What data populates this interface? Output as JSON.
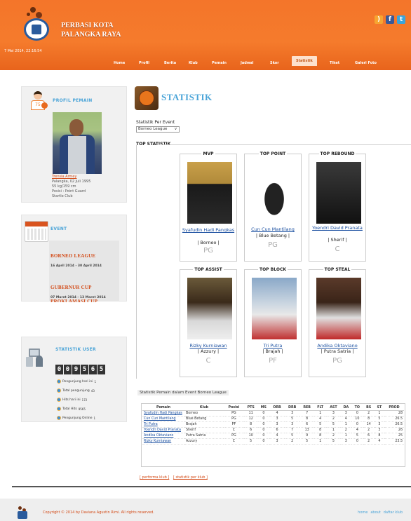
{
  "header": {
    "site_title": "PERBASI KOTA\nPALANGKA RAYA",
    "datetime": "7 Mei 2014, 22:16:54",
    "social": [
      "rss-icon",
      "facebook-icon",
      "twitter-icon"
    ]
  },
  "nav": {
    "items": [
      "Home",
      "Profil",
      "Berita",
      "Klub",
      "Pemain",
      "Jadwal",
      "Skor",
      "Statistik",
      "Tiket",
      "Galeri Foto"
    ],
    "active": "Statistik"
  },
  "profil": {
    "title": "PROFIL PEMAIN",
    "jersey": "75",
    "name": "Trensia Armey",
    "born": "Palangka, 02 Juli 1995",
    "body": "55 kg/159 cm",
    "position": "Posisi : Point Guard",
    "club": "Startle Club"
  },
  "event": {
    "title": "EVENT",
    "items": [
      {
        "name": "BORNEO LEAGUE",
        "date": "16 April 2014 - 30 April 2014"
      },
      {
        "name": "GUBERNUR CUP",
        "date": "07 Maret 2014 - 13 Maret 2014"
      },
      {
        "name": "PROKLAMASI CUP",
        "date": ""
      }
    ]
  },
  "stat_user": {
    "title": "STATISTIK USER",
    "counter": [
      "0",
      "0",
      "9",
      "5",
      "6",
      "5"
    ],
    "rows": [
      {
        "label": "Pengunjung hari ini",
        "value": "1"
      },
      {
        "label": "Total pengunjung",
        "value": "43"
      },
      {
        "label": "Hits hari ini",
        "value": "172"
      },
      {
        "label": "Total Hits",
        "value": "9565"
      },
      {
        "label": "Pengunjung Online",
        "value": "1"
      }
    ]
  },
  "main": {
    "title": "STATISTIK",
    "select_label": "Statistik Per Event",
    "select_value": "Borneo League",
    "top_label": "TOP STATISTIK"
  },
  "top_cards": [
    {
      "title": "MVP",
      "name": "Syafudin Hadi Pangkas",
      "club": "| Borneo |",
      "pos": "PG"
    },
    {
      "title": "TOP POINT",
      "name": "Cun Cun Mantilang",
      "club": "| Blue Betang |",
      "pos": "PG"
    },
    {
      "title": "TOP REBOUND",
      "name": "Yoendri David Pranata",
      "club": "| Sherif |",
      "pos": "C"
    },
    {
      "title": "TOP ASSIST",
      "name": "Rizky Kurniawan",
      "club": "| Azzury |",
      "pos": "C"
    },
    {
      "title": "TOP BLOCK",
      "name": "Tri Putra",
      "club": "| Brajah |",
      "pos": "PF"
    },
    {
      "title": "TOP STEAL",
      "name": "Andika Oktaviano",
      "club": "| Putra Satria |",
      "pos": "PG"
    }
  ],
  "table": {
    "caption": "Statistik Pemain dalam Event Borneo League",
    "headers": [
      "Pemain",
      "Klub",
      "Posisi",
      "PTS",
      "MS",
      "ORB",
      "DRB",
      "REB",
      "FLT",
      "AST",
      "DA",
      "TO",
      "BS",
      "ST",
      "PROD"
    ],
    "rows": [
      [
        "Syafudin Hadi Pangkas",
        "Borneo",
        "PG",
        "11",
        "0",
        "4",
        "3",
        "7",
        "1",
        "3",
        "3",
        "0",
        "2",
        "1",
        "28"
      ],
      [
        "Cun Cun Mantilang",
        "Blue Betang",
        "PG",
        "12",
        "0",
        "3",
        "5",
        "8",
        "4",
        "2",
        "4",
        "10",
        "8",
        "5",
        "26.5"
      ],
      [
        "Tri Putra",
        "Brajah",
        "PF",
        "8",
        "0",
        "3",
        "3",
        "6",
        "5",
        "5",
        "1",
        "0",
        "14",
        "3",
        "26.5"
      ],
      [
        "Yoendri David Pranata",
        "Sherif",
        "C",
        "6",
        "0",
        "6",
        "7",
        "13",
        "8",
        "1",
        "2",
        "4",
        "2",
        "3",
        "26"
      ],
      [
        "Andika Oktaviano",
        "Putra Satria",
        "PG",
        "10",
        "0",
        "4",
        "5",
        "9",
        "8",
        "2",
        "1",
        "5",
        "6",
        "8",
        "25"
      ],
      [
        "Rizky Kurniawan",
        "Azzury",
        "C",
        "5",
        "0",
        "3",
        "2",
        "5",
        "1",
        "5",
        "3",
        "0",
        "2",
        "4",
        "23.5"
      ]
    ]
  },
  "bottom_links": [
    "[ performa klub ]",
    "[ statistik per klub ]"
  ],
  "footer": {
    "copyright": "Copyright © 2014 by Daviana Agustin Rimi. All rights reserved.",
    "nav": [
      "home",
      "about",
      "daftar klub"
    ]
  }
}
